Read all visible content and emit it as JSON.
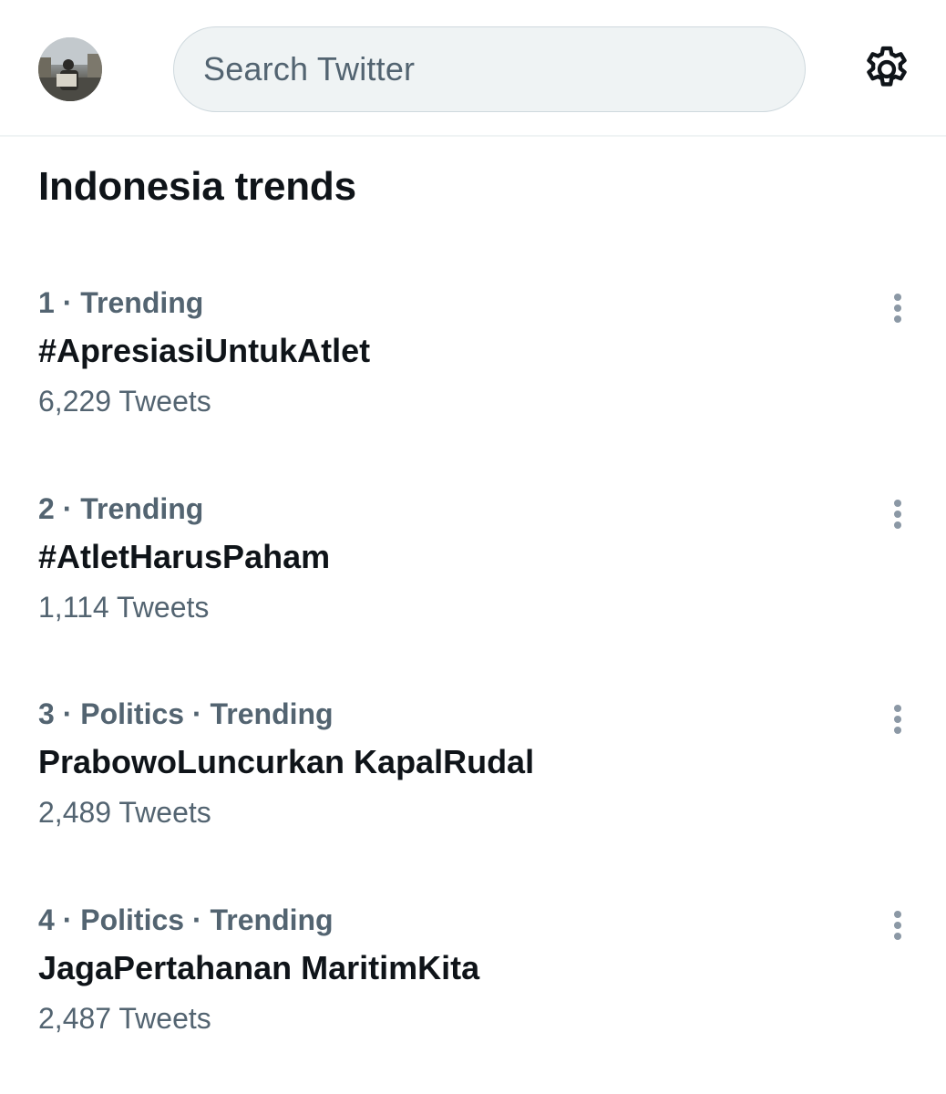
{
  "header": {
    "search_placeholder": "Search Twitter",
    "avatar_icon": "user-avatar",
    "settings_icon": "gear-icon"
  },
  "section": {
    "title": "Indonesia trends"
  },
  "trends": [
    {
      "meta": "1 · Trending",
      "name": "#ApresiasiUntukAtlet",
      "count": "6,229 Tweets"
    },
    {
      "meta": "2 · Trending",
      "name": "#AtletHarusPaham",
      "count": "1,114 Tweets"
    },
    {
      "meta": "3 · Politics · Trending",
      "name": "PrabowoLuncurkan KapalRudal",
      "count": "2,489 Tweets"
    },
    {
      "meta": "4 · Politics · Trending",
      "name": "JagaPertahanan MaritimKita",
      "count": "2,487 Tweets"
    }
  ],
  "colors": {
    "text_primary": "#0f1419",
    "text_secondary": "#536471",
    "search_bg": "#eff3f4",
    "divider": "#eff3f4"
  }
}
